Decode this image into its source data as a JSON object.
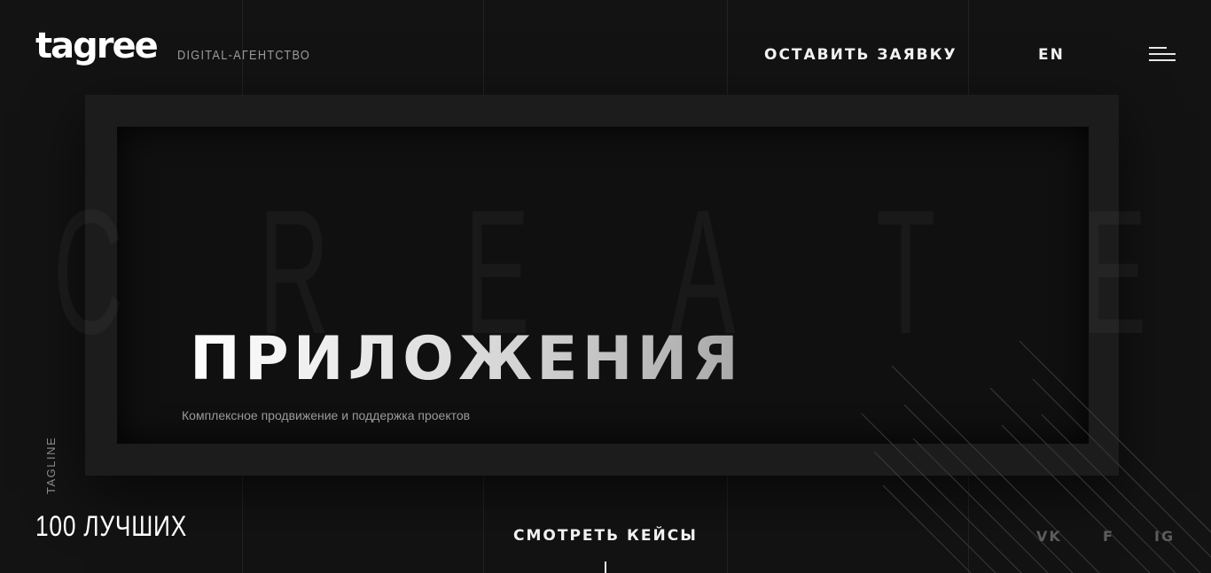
{
  "header": {
    "logo_text": "tagree",
    "agency_label": "DIGITAL-АГЕНТСТВО",
    "cta_label": "ОСТАВИТЬ ЗАЯВКУ",
    "lang_label": "EN",
    "menu_icon": "hamburger-menu-icon"
  },
  "hero": {
    "background_word": [
      "C",
      "R",
      "E",
      "A",
      "T",
      "E"
    ],
    "title": "ПРИЛОЖЕНИЯ",
    "subtitle": "Комплексное продвижение и поддержка проектов"
  },
  "tagline": {
    "label": "TAGLINE",
    "text": "100 ЛУЧШИХ"
  },
  "footer": {
    "cases_label": "СМОТРЕТЬ КЕЙСЫ",
    "social": [
      "VK",
      "F",
      "IG"
    ]
  },
  "colors": {
    "background": "#131313",
    "frame": "#1c1c1c",
    "text_primary": "#ffffff",
    "text_muted": "#9a9a9a",
    "social_muted": "#5c5c5c"
  }
}
